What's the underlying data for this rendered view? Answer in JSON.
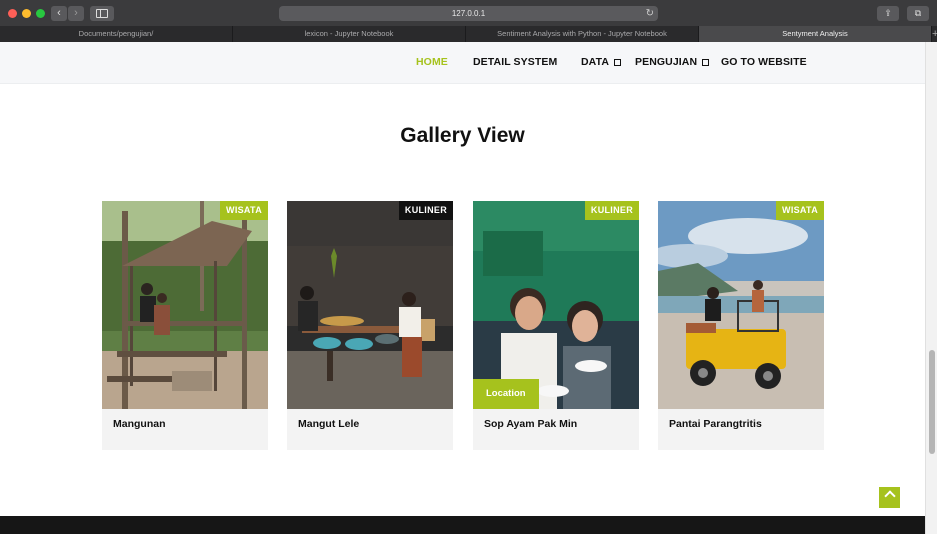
{
  "browser": {
    "url": "127.0.0.1",
    "tabs": [
      {
        "label": "Documents/pengujian/"
      },
      {
        "label": "lexicon - Jupyter Notebook"
      },
      {
        "label": "Sentiment Analysis with Python - Jupyter Notebook"
      },
      {
        "label": "Sentyment Analysis"
      }
    ],
    "new_tab_label": "+"
  },
  "nav": {
    "home": "HOME",
    "detail": "DETAIL SYSTEM",
    "data": "DATA",
    "pengujian": "PENGUJIAN",
    "website": "GO TO WEBSITE"
  },
  "gallery": {
    "title": "Gallery View",
    "cards": [
      {
        "name": "Mangunan",
        "badge": "WISATA",
        "badge_color": "#a6c21d"
      },
      {
        "name": "Mangut Lele",
        "badge": "KULINER",
        "badge_color": "#111111"
      },
      {
        "name": "Sop Ayam Pak Min",
        "badge": "KULINER",
        "badge_color": "#a6c21d",
        "overlay": "Location"
      },
      {
        "name": "Pantai Parangtritis",
        "badge": "WISATA",
        "badge_color": "#a6c21d"
      }
    ]
  },
  "colors": {
    "accent": "#a6c21d"
  }
}
